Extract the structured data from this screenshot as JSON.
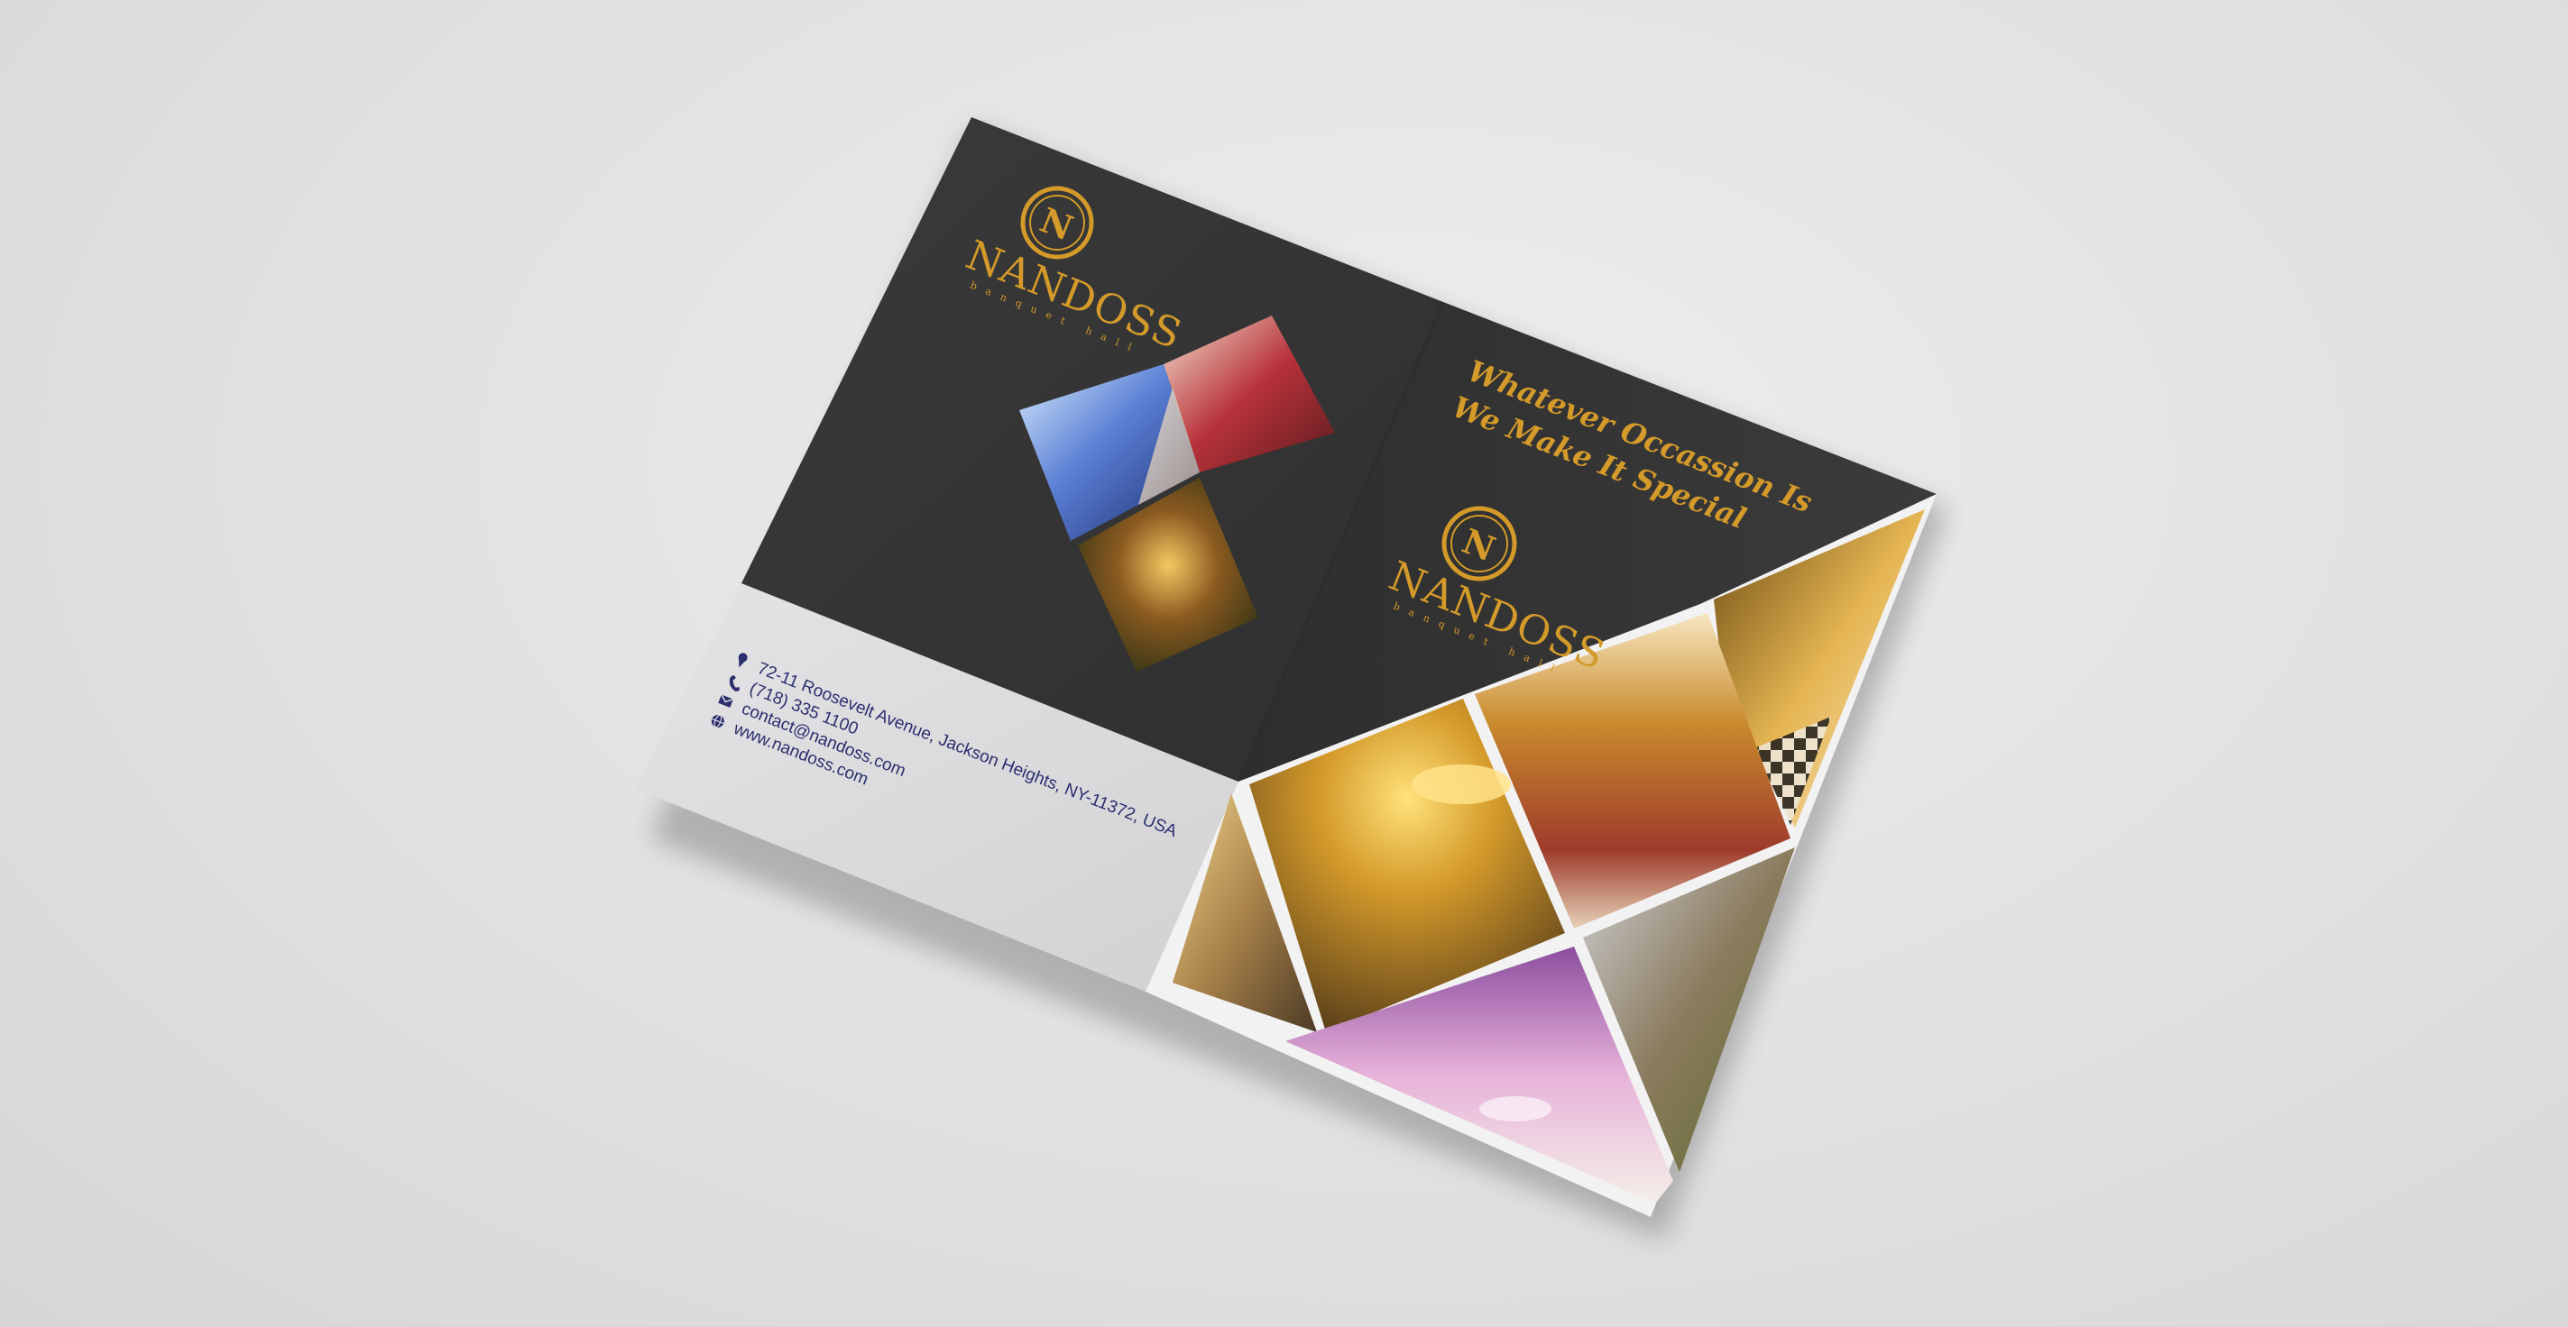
{
  "brand": {
    "name": "NANDOSS",
    "tagline": "banquet hall",
    "monogram": "N"
  },
  "slogan": {
    "line1": "Whatever Occassion Is",
    "line2": "We Make It Special"
  },
  "contact": {
    "address": "72-11 Roosevelt Avenue, Jackson Heights, NY-11372, USA",
    "phone": "(718) 335 1100",
    "email": "contact@nandoss.com",
    "website": "www.nandoss.com",
    "icons": [
      "location-pin-icon",
      "phone-icon",
      "email-icon",
      "globe-icon"
    ]
  },
  "colors": {
    "gold": "#d49a2a",
    "panel_dark": "#363636",
    "panel_light": "#dcdcde",
    "contact_text": "#2b2e6e",
    "background": "#e3e3e3"
  }
}
